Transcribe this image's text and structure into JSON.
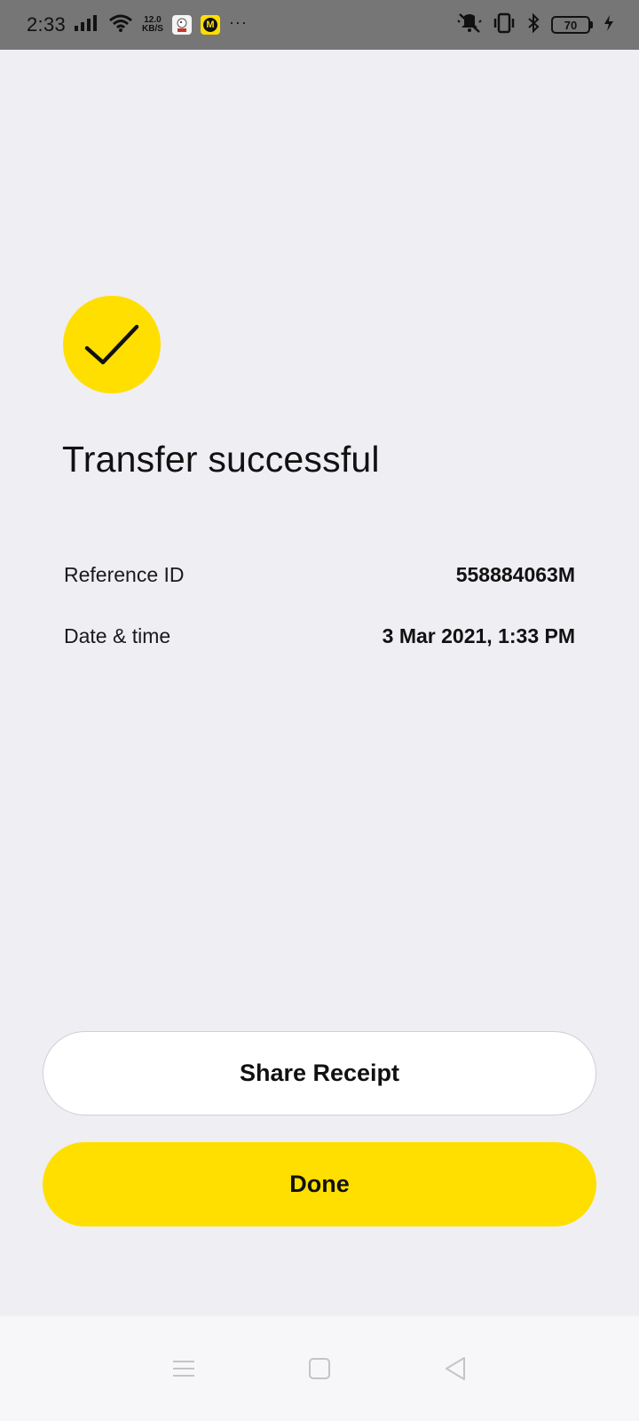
{
  "status_bar": {
    "time": "2:33",
    "speed_value": "12.0",
    "speed_unit": "KB/S",
    "battery_level": "70",
    "more_indicator": "···"
  },
  "main": {
    "title": "Transfer successful",
    "details": [
      {
        "label": "Reference ID",
        "value": "558884063M"
      },
      {
        "label": "Date & time",
        "value": "3 Mar 2021, 1:33 PM"
      }
    ]
  },
  "actions": {
    "share_label": "Share Receipt",
    "done_label": "Done"
  },
  "colors": {
    "accent": "#FFDF00",
    "background": "#EEEEF3",
    "status_bar": "#767676"
  },
  "icons": [
    "success-check-icon",
    "signal-icon",
    "wifi-icon",
    "mute-icon",
    "vibrate-icon",
    "bluetooth-icon",
    "battery-icon",
    "charging-icon",
    "menu-nav-icon",
    "home-nav-icon",
    "back-nav-icon"
  ]
}
